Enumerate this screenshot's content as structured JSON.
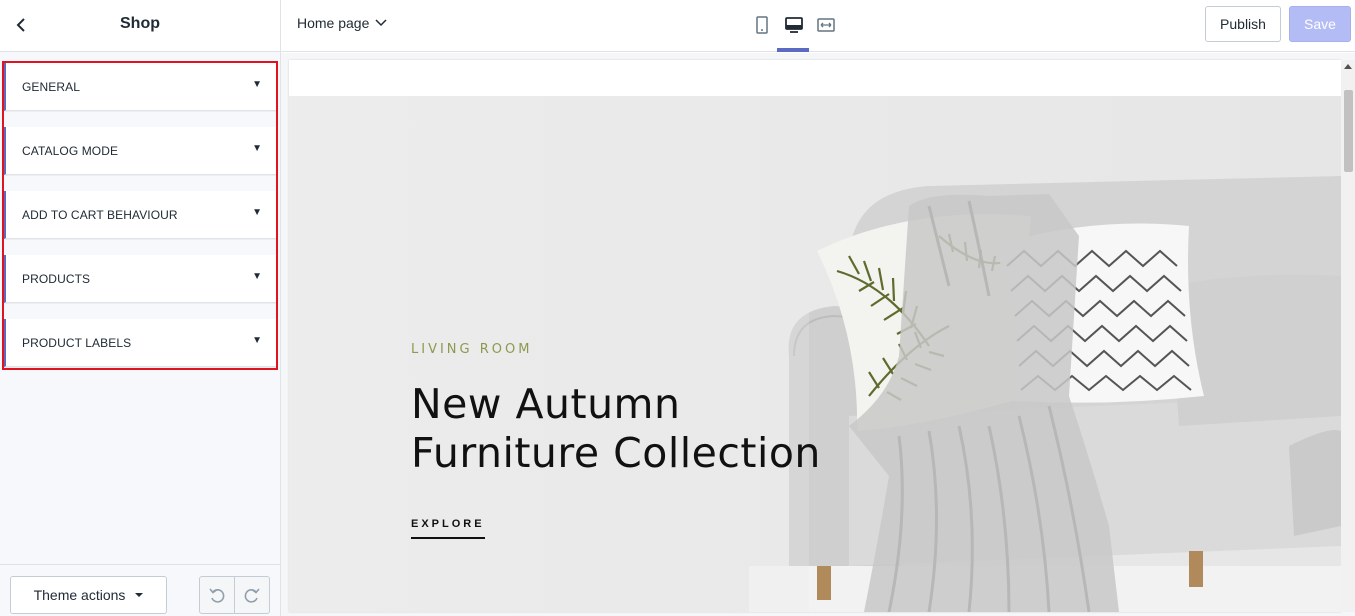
{
  "sidebar": {
    "title": "Shop",
    "panels": [
      {
        "label": "GENERAL"
      },
      {
        "label": "CATALOG MODE"
      },
      {
        "label": "ADD TO CART BEHAVIOUR"
      },
      {
        "label": "PRODUCTS"
      },
      {
        "label": "PRODUCT LABELS"
      }
    ],
    "footer": {
      "theme_actions_label": "Theme actions"
    }
  },
  "topbar": {
    "page_selector": "Home page",
    "devices": [
      "mobile",
      "desktop",
      "full-width"
    ],
    "active_device": "desktop",
    "publish_label": "Publish",
    "save_label": "Save"
  },
  "preview": {
    "hero": {
      "kicker": "LIVING ROOM",
      "title_line1": "New Autumn",
      "title_line2": "Furniture Collection",
      "cta": "EXPLORE"
    }
  },
  "colors": {
    "accent": "#5c6ac4",
    "save_disabled": "#b3bcf5",
    "highlight_border": "#e0141e",
    "kicker": "#8c9a4f"
  },
  "icons": {
    "back": "chevron-left-icon",
    "page_dropdown": "chevron-down-icon",
    "panel_toggle": "caret-down-icon",
    "undo": "undo-icon",
    "redo": "redo-icon"
  }
}
